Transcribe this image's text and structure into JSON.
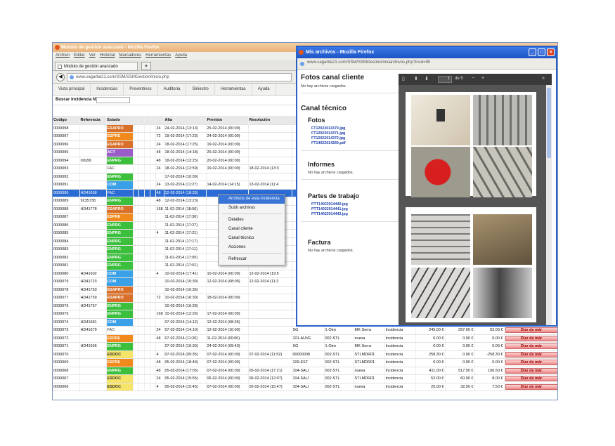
{
  "main_window": {
    "title": "Modulo de gestión avanzado - Mozilla Firefox",
    "menu": [
      "Archivo",
      "Editar",
      "Ver",
      "Historial",
      "Marcadores",
      "Herramientas",
      "Ayuda"
    ],
    "tab_title": "Modulo de gestión avanzado",
    "url": "www.sagarbe21.com/SSM/SSMGestion/inicio.php",
    "app_nav": [
      "Vista principal",
      "Incidencias",
      "Preventivos",
      "Auditoria",
      "Siniestro",
      "Herramientas",
      "Ayuda"
    ],
    "search_label": "Buscar incidencia Nº",
    "columns": [
      "Codigo",
      "Referencia",
      "Estado",
      "",
      "",
      "",
      "",
      "",
      "Alta",
      "Previsto",
      "Resolución"
    ],
    "rows": [
      [
        "0000098",
        "",
        "ESAPRO",
        "24",
        "24-02-2014 (13:13)",
        "25-02-2014 (00:00)",
        "",
        "#d9702a"
      ],
      [
        "0000097",
        "",
        "ESPRE",
        "72",
        "19-02-2014 (17:23)",
        "24-02-2014 (00:00)",
        "",
        "#f08a1c"
      ],
      [
        "0000096",
        "",
        "ESAPRO",
        "24",
        "18-02-2014 (17:25)",
        "19-02-2014 (00:00)",
        "",
        "#d9702a"
      ],
      [
        "0000095",
        "",
        "ACT",
        "48",
        "18-02-2014 (14:18)",
        "26-02-2014 (00:00)",
        "",
        "#9a5cc6"
      ],
      [
        "0000094",
        "rtrty56",
        "ENPRG",
        "48",
        "18-02-2014 (13:25)",
        "20-02-2014 (00:00)",
        "",
        "#3cbf3c"
      ],
      [
        "0000093",
        "",
        "FAC",
        "24",
        "18-02-2014 (12:59)",
        "19-02-2014 (00:00)",
        "18-02-2014 (13:3",
        "#ffffff"
      ],
      [
        "0000092",
        "",
        "ENPRG",
        "",
        "17-02-2014 (10:09)",
        "",
        "",
        "#3cbf3c"
      ],
      [
        "0000091",
        "",
        "COM",
        "24",
        "13-02-2014 (11:27)",
        "14-02-2014 (14:15)",
        "13-02-2014 (11:4",
        "#3aa0e8"
      ],
      [
        "0000090",
        "HD41658",
        "FAC",
        "48",
        "12-02-2014 (18:33)",
        "",
        "",
        "#ffffff"
      ],
      [
        "0000089",
        "9235738",
        "ENPRG",
        "48",
        "12-02-2014 (13:23)",
        "",
        "",
        "#3cbf3c"
      ],
      [
        "0000088",
        "HD41778",
        "ESAPRO",
        "168",
        "11-02-2014 (18:56)",
        "",
        "",
        "#d9702a"
      ],
      [
        "0000087",
        "",
        "ESPRE",
        "",
        "11-02-2014 (17:30)",
        "",
        "",
        "#f08a1c"
      ],
      [
        "0000086",
        "",
        "ENPRG",
        "",
        "11-02-2014 (17:27)",
        "",
        "",
        "#3cbf3c"
      ],
      [
        "0000085",
        "",
        "ENPRG",
        "4",
        "11-02-2014 (17:21)",
        "",
        "",
        "#3cbf3c"
      ],
      [
        "0000084",
        "",
        "ENPRG",
        "",
        "11-02-2014 (17:17)",
        "",
        "",
        "#3cbf3c"
      ],
      [
        "0000083",
        "",
        "ENPRG",
        "",
        "11-02-2014 (17:11)",
        "",
        "",
        "#3cbf3c"
      ],
      [
        "0000082",
        "",
        "ENPRG",
        "",
        "11-02-2014 (17:05)",
        "",
        "",
        "#3cbf3c"
      ],
      [
        "0000081",
        "",
        "ENPRG",
        "",
        "11-02-2014 (17:01)",
        "",
        "",
        "#3cbf3c"
      ],
      [
        "0000080",
        "HD41602",
        "COM",
        "4",
        "10-02-2014 (17:41)",
        "10-02-2014 (00:00)",
        "12-02-2014 (19:5",
        "#3aa0e8"
      ],
      [
        "0000079",
        "HD41723",
        "COM",
        "",
        "10-02-2014 (16:39)",
        "12-02-2014 (08:05)",
        "12-02-2014 (11:2",
        "#3aa0e8"
      ],
      [
        "0000078",
        "HD41753",
        "ESAPRO",
        "",
        "10-02-2014 (16:36)",
        "",
        "",
        "#d9702a"
      ],
      [
        "0000077",
        "HD41759",
        "ESAPRO",
        "72",
        "10-02-2014 (16:30)",
        "18-02-2014 (00:00)",
        "",
        "#d9702a"
      ],
      [
        "0000076",
        "HD41757",
        "ENPRG",
        "",
        "10-02-2014 (16:28)",
        "",
        "",
        "#3cbf3c"
      ],
      [
        "0000075",
        "",
        "ENPRG",
        "168",
        "10-02-2014 (12:26)",
        "17-02-2014 (00:00)",
        "",
        "#3cbf3c"
      ],
      [
        "0000074",
        "HD41681",
        "COM",
        "",
        "07-02-2014 (14:12)",
        "12-02-2014 (08:35)",
        "",
        "#3aa0e8"
      ],
      [
        "0000073",
        "HD41679",
        "FAC",
        "24",
        "07-02-2014 (14:10)",
        "12-02-2014 (10:00)",
        "",
        "#ffffff"
      ],
      [
        "0000072",
        "",
        "ESPRE",
        "48",
        "07-02-2014 (11:20)",
        "11-02-2014 (00:00)",
        "",
        "#f08a1c"
      ],
      [
        "0000071",
        "HD41666",
        "ENPRG",
        "",
        "07-02-2014 (10:30)",
        "24-02-2014 (09:40)",
        "",
        "#3cbf3c"
      ],
      [
        "0000070",
        "",
        "ESDOC",
        "4",
        "07-02-2014 (09:35)",
        "07-02-2014 (00:00)",
        "07-02-2014 (11:52)",
        "#f5e36a"
      ],
      [
        "0000069",
        "",
        "ESPRE",
        "48",
        "05-02-2014 (18:49)",
        "07-02-2014 (00:00)",
        "",
        "#f08a1c"
      ],
      [
        "0000068",
        "",
        "ENPRG",
        "48",
        "05-02-2014 (17:05)",
        "07-02-2014 (00:00)",
        "05-02-2014 (17:21)",
        "#3cbf3c"
      ],
      [
        "0000067",
        "",
        "ESDOC",
        "24",
        "05-02-2014 (15:55)",
        "06-02-2014 (00:00)",
        "06-02-2014 (12:07)",
        "#f5e36a"
      ],
      [
        "0000066",
        "",
        "ESDOC",
        "4",
        "05-02-2014 (15:45)",
        "07-02-2014 (00:00)",
        "05-02-2014 (15:47)",
        "#f5e36a"
      ]
    ],
    "extra_rows": [
      [
        "SG",
        "1-Otro",
        "MK-Serra",
        "Incidencia",
        "245.00 €",
        "297.00 €",
        "52.00 €"
      ],
      [
        "101-AUVE",
        "002-STL",
        "nueva",
        "Incidencia",
        "0.00 €",
        "0.00 €",
        "0.00 €"
      ],
      [
        "SG",
        "1-Otro",
        "MK-Serra",
        "Incidencia",
        "0.00 €",
        "0.00 €",
        "0.00 €"
      ],
      [
        "00000008",
        "002-STL",
        "STLMDR01",
        "Incidencia",
        "258.30 €",
        "0.00 €",
        "-258.30 €"
      ],
      [
        "109-EST",
        "002-STL",
        "STLMDR01",
        "Incidencia",
        "0.00 €",
        "0.00 €",
        "0.00 €"
      ],
      [
        "104-SALI",
        "002-STL",
        "nueva",
        "Incidencia",
        "411.00 €",
        "517.50 €",
        "106.50 €"
      ],
      [
        "104-SALI",
        "002-STL",
        "STLMDR01",
        "Incidencia",
        "52.00 €",
        "60.00 €",
        "8.00 €"
      ],
      [
        "104-SALI",
        "002-STL",
        "nueva",
        "Incidencia",
        "25.00 €",
        "32.50 €",
        "7.50 €"
      ]
    ],
    "diar_label": "Diar de már",
    "context_menu": [
      "Archivos de esta incidencia",
      "Subir archivos",
      "Detalles",
      "Canal cliente",
      "Canal técnico",
      "Acciones",
      "Refrescar"
    ]
  },
  "popup": {
    "title": "Mis archivos - Mozilla Firefox",
    "url": "www.sagarbe21.com/SSM/SSMGestion/misarchivos.php?incd=90",
    "canal_cliente": "Fotos canal cliente",
    "no_files": "No hay archivos cargados.",
    "canal_tecnico": "Canal técnico",
    "fotos": "Fotos",
    "fotos_files": [
      "FT12022014370.jpg",
      "FT12022014371.jpg",
      "FT12022014372.jpg",
      "FT14022014260.pdf"
    ],
    "informes": "Informes",
    "partes": "Partes de trabajo",
    "partes_files": [
      "PTT14022014440.jpg",
      "PTT14022014441.jpg",
      "PTT14022014442.jpg"
    ],
    "factura": "Factura",
    "viewer": {
      "page": "1",
      "of": "de 5"
    }
  }
}
